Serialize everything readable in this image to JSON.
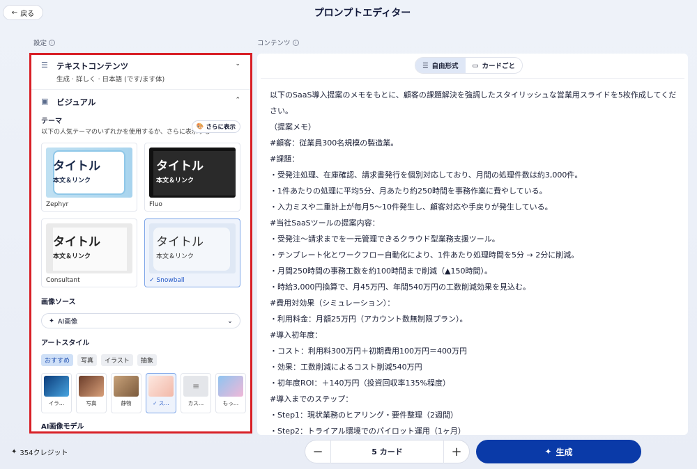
{
  "header": {
    "back_label": "戻る",
    "title": "プロンプトエディター"
  },
  "settings_label": "設定",
  "content_label": "コンテンツ",
  "text_content": {
    "title": "テキストコンテンツ",
    "summary": "生成 · 詳しく · 日本語 (です/ます体)"
  },
  "visual": {
    "title": "ビジュアル",
    "theme_label": "テーマ",
    "theme_desc": "以下の人気テーマのいずれかを使用するか、さらに表示する",
    "more_label": "さらに表示",
    "themes": [
      {
        "name": "Zephyr",
        "preview_title": "タイトル",
        "preview_body": "本文＆リンク"
      },
      {
        "name": "Fluo",
        "preview_title": "タイトル",
        "preview_body": "本文＆リンク"
      },
      {
        "name": "Consultant",
        "preview_title": "タイトル",
        "preview_body": "本文＆リンク"
      },
      {
        "name": "Snowball",
        "preview_title": "タイトル",
        "preview_body": "本文＆リンク",
        "selected": true
      }
    ],
    "image_source_label": "画像ソース",
    "image_source_value": "AI画像",
    "art_style_label": "アートスタイル",
    "chips": [
      "おすすめ",
      "写真",
      "イラスト",
      "抽象"
    ],
    "styles": [
      "イラ…",
      "写真",
      "静物",
      "ス…",
      "カス…",
      "もっ…"
    ],
    "ai_model_label": "AI画像モデル"
  },
  "view_tabs": [
    "自由形式",
    "カードごと"
  ],
  "content_lines": [
    "以下のSaaS導入提案のメモをもとに、顧客の課題解決を強調したスタイリッシュな営業用スライドを5枚作成してください。",
    "（提案メモ）",
    "#顧客：従業員300名規模の製造業。",
    "#課題：",
    "・受発注処理、在庫確認、請求書発行を個別対応しており、月間の処理件数は約3,000件。",
    "・1件あたりの処理に平均5分、月あたり約250時間を事務作業に費やしている。",
    "・入力ミスや二重計上が毎月5〜10件発生し、顧客対応や手戻りが発生している。",
    "#当社SaaSツールの提案内容：",
    "・受発注〜請求までを一元管理できるクラウド型業務支援ツール。",
    "・テンプレート化とワークフロー自動化により、1件あたり処理時間を5分 → 2分に削減。",
    "・月間250時間の事務工数を約100時間まで削減（▲150時間）。",
    "・時給3,000円換算で、月45万円、年間540万円の工数削減効果を見込む。",
    "#費用対効果（シミュレーション）：",
    "・利用料金：月額25万円（アカウント数無制限プラン）。",
    "#導入初年度：",
    "・コスト：利用料300万円＋初期費用100万円＝400万円",
    "・効果：工数削減によるコスト削減540万円",
    "・初年度ROI：＋140万円（投資回収率135%程度）",
    "#導入までのステップ：",
    "・Step1：現状業務のヒアリング・要件整理（2週間）",
    "・Step2：トライアル環境でのパイロット運用（1ヶ月）"
  ],
  "credits": "354クレジット",
  "card_count": "5 カード",
  "generate_label": "生成"
}
